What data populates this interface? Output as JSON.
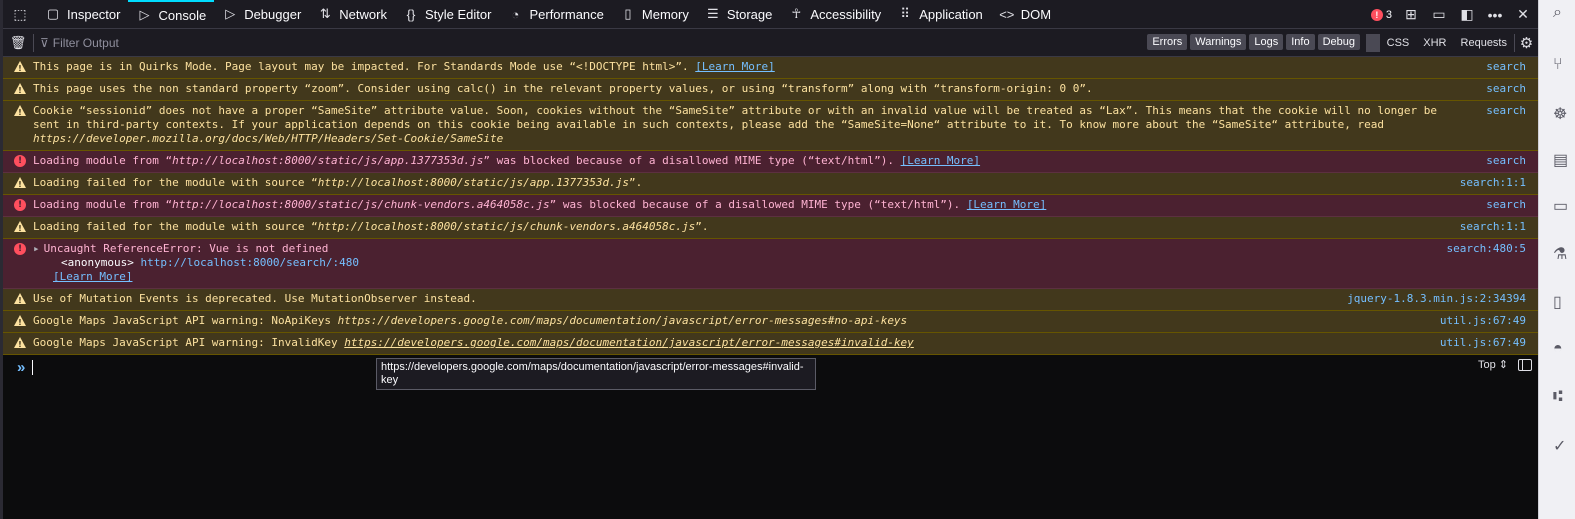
{
  "tabs": [
    {
      "label": "Inspector",
      "icon": "inspector-icon"
    },
    {
      "label": "Console",
      "icon": "console-icon",
      "active": true
    },
    {
      "label": "Debugger",
      "icon": "debugger-icon"
    },
    {
      "label": "Network",
      "icon": "network-icon"
    },
    {
      "label": "Style Editor",
      "icon": "style-editor-icon"
    },
    {
      "label": "Performance",
      "icon": "performance-icon"
    },
    {
      "label": "Memory",
      "icon": "memory-icon"
    },
    {
      "label": "Storage",
      "icon": "storage-icon"
    },
    {
      "label": "Accessibility",
      "icon": "accessibility-icon"
    },
    {
      "label": "Application",
      "icon": "application-icon"
    },
    {
      "label": "DOM",
      "icon": "dom-icon"
    }
  ],
  "error_count": "3",
  "filter": {
    "placeholder": "Filter Output"
  },
  "levels": [
    "Errors",
    "Warnings",
    "Logs",
    "Info",
    "Debug"
  ],
  "request_filters": [
    "CSS",
    "XHR",
    "Requests"
  ],
  "messages": [
    {
      "type": "warn",
      "text": "This page is in Quirks Mode. Page layout may be impacted. For Standards Mode use “<!DOCTYPE html>”.",
      "learn": "[Learn More]",
      "location": "search"
    },
    {
      "type": "warn",
      "text": "This page uses the non standard property “zoom”. Consider using calc() in the relevant property values, or using “transform” along with “transform-origin: 0 0”.",
      "location": "search"
    },
    {
      "type": "warn",
      "text": "Cookie “sessionid” does not have a proper “SameSite” attribute value. Soon, cookies without the “SameSite” attribute or with an invalid value will be treated as “Lax”. This means that the cookie will no longer be sent in third-party contexts. If your application depends on this cookie being available in such contexts, please add the “SameSite=None“ attribute to it. To know more about the “SameSite“ attribute, read",
      "italic": "https://developer.mozilla.org/docs/Web/HTTP/Headers/Set-Cookie/SameSite",
      "location": "search"
    },
    {
      "type": "error",
      "pre": "Loading module from “",
      "italic": "http://localhost:8000/static/js/app.1377353d.js",
      "post": "” was blocked because of a disallowed MIME type (“text/html”).",
      "learn": "[Learn More]",
      "location": "search"
    },
    {
      "type": "warn",
      "pre": "Loading failed for the module with source “",
      "italic": "http://localhost:8000/static/js/app.1377353d.js",
      "post": "”.",
      "location": "search:1:1"
    },
    {
      "type": "error",
      "pre": "Loading module from “",
      "italic": "http://localhost:8000/static/js/chunk-vendors.a464058c.js",
      "post": "” was blocked because of a disallowed MIME type (“text/html”).",
      "learn": "[Learn More]",
      "location": "search"
    },
    {
      "type": "warn",
      "pre": "Loading failed for the module with source “",
      "italic": "http://localhost:8000/static/js/chunk-vendors.a464058c.js",
      "post": "”.",
      "location": "search:1:1"
    },
    {
      "type": "error",
      "text": "Uncaught ReferenceError: Vue is not defined",
      "anon": "<anonymous>",
      "anon_link": "http://localhost:8000/search/:480",
      "learn": "[Learn More]",
      "location": "search:480:5"
    },
    {
      "type": "warn",
      "text": "Use of Mutation Events is deprecated. Use MutationObserver instead.",
      "location": "jquery-1.8.3.min.js:2:34394"
    },
    {
      "type": "warn",
      "pre": "Google Maps JavaScript API warning: NoApiKeys ",
      "italic": "https://developers.google.com/maps/documentation/javascript/error-messages#no-api-keys",
      "location": "util.js:67:49"
    },
    {
      "type": "warn",
      "pre": "Google Maps JavaScript API warning: InvalidKey ",
      "italic": "https://developers.google.com/maps/documentation/javascript/error-messages#invalid-key",
      "location": "util.js:67:49"
    }
  ],
  "prompt": {
    "eval_context": "Top ⇕"
  },
  "tooltip": "https://developers.google.com/maps/documentation/javascript/error-messages#invalid-key",
  "colors": {
    "warn_bg": "#42381c",
    "error_bg": "#4b2130",
    "link": "#75bfff",
    "active_tab": "#00ddff"
  }
}
